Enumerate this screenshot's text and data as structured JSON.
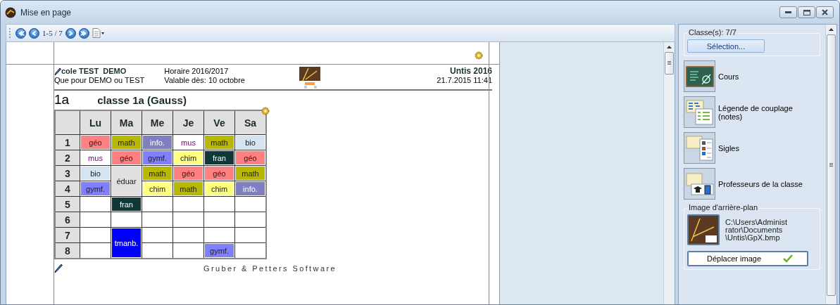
{
  "window": {
    "title": "Mise en page"
  },
  "toolbar": {
    "page_range": "1-5 / 7"
  },
  "page": {
    "school": "cole TEST  DEMO",
    "school_note": "Que pour DEMO ou TEST",
    "schedule": "Horaire 2016/2017",
    "valid_from": "Valable dès: 10 octobre",
    "product": "Untis 2016",
    "timestamp": "21.7.2015 11:41",
    "class_code": "1a",
    "class_name": "classe 1a (Gauss)",
    "footer": "Gruber & Petters Software"
  },
  "table": {
    "columns": [
      "Lu",
      "Ma",
      "Me",
      "Je",
      "Ve",
      "Sa"
    ],
    "rows": [
      {
        "period": "1",
        "cells": [
          {
            "text": "géo",
            "color": "#ff8080",
            "kind": "single"
          },
          {
            "text": "math",
            "color": "#b8b800",
            "kind": "single"
          },
          {
            "text": "info.",
            "color": "#8080c0",
            "kind": "single"
          },
          {
            "text": "mus",
            "color": "#ffffff",
            "kind": "single"
          },
          {
            "text": "math",
            "color": "#b8b800",
            "kind": "single"
          },
          {
            "text": "bio",
            "color": "#d4e4f0",
            "kind": "single"
          }
        ]
      },
      {
        "period": "2",
        "cells": [
          {
            "text": "mus",
            "color": "#ffffff",
            "kind": "single"
          },
          {
            "text": "géo",
            "color": "#ff8080",
            "kind": "single"
          },
          {
            "text": "gymf.",
            "color": "#8080ff",
            "kind": "single"
          },
          {
            "text": "chim",
            "color": "#ffff80",
            "kind": "single"
          },
          {
            "text": "fran",
            "color": "#103838",
            "kind": "single"
          },
          {
            "text": "géo",
            "color": "#ff8080",
            "kind": "single"
          }
        ]
      },
      {
        "period": "3",
        "cells": [
          {
            "text": "bio",
            "color": "#d4e4f0",
            "kind": "single"
          },
          {
            "text": "éduar",
            "color": "#e0e0e0",
            "kind": "double"
          },
          {
            "text": "math",
            "color": "#b8b800",
            "kind": "single"
          },
          {
            "text": "géo",
            "color": "#ff8080",
            "kind": "single"
          },
          {
            "text": "géo",
            "color": "#ff8080",
            "kind": "single"
          },
          {
            "text": "math",
            "color": "#b8b800",
            "kind": "single"
          }
        ]
      },
      {
        "period": "4",
        "cells": [
          {
            "text": "gymf.",
            "color": "#8080ff",
            "kind": "single"
          },
          {
            "kind": "covered"
          },
          {
            "text": "chim",
            "color": "#ffff80",
            "kind": "single"
          },
          {
            "text": "math",
            "color": "#b8b800",
            "kind": "single"
          },
          {
            "text": "chim",
            "color": "#ffff80",
            "kind": "single"
          },
          {
            "text": "info.",
            "color": "#8080c0",
            "kind": "single"
          }
        ]
      },
      {
        "period": "5",
        "cells": [
          {
            "kind": "single"
          },
          {
            "text": "fran",
            "color": "#103838",
            "kind": "single"
          },
          {
            "kind": "single"
          },
          {
            "kind": "single"
          },
          {
            "kind": "single"
          },
          {
            "kind": "single"
          }
        ]
      },
      {
        "period": "6",
        "cells": [
          {
            "kind": "single"
          },
          {
            "kind": "single"
          },
          {
            "kind": "single"
          },
          {
            "kind": "single"
          },
          {
            "kind": "single"
          },
          {
            "kind": "single"
          }
        ]
      },
      {
        "period": "7",
        "cells": [
          {
            "kind": "single"
          },
          {
            "text": "tmanb.",
            "color": "#0000ff",
            "kind": "double"
          },
          {
            "kind": "single"
          },
          {
            "kind": "single"
          },
          {
            "kind": "single"
          },
          {
            "kind": "single"
          }
        ]
      },
      {
        "period": "8",
        "cells": [
          {
            "kind": "single"
          },
          {
            "kind": "covered"
          },
          {
            "kind": "single"
          },
          {
            "kind": "single"
          },
          {
            "text": "gymf.",
            "color": "#8080ff",
            "kind": "single"
          },
          {
            "kind": "single"
          }
        ]
      }
    ]
  },
  "side_panel": {
    "classes_label": "Classe(s): 7/7",
    "selection_button": "Sélection...",
    "items": [
      {
        "label": "Cours",
        "kind": "board"
      },
      {
        "label": "Légende de couplage (notes)",
        "kind": "legend"
      },
      {
        "label": "Sigles",
        "kind": "sigles"
      },
      {
        "label": "Professeurs de la classe",
        "kind": "teachers"
      }
    ],
    "background_image": {
      "label": "Image d'arrière-plan",
      "path": "C:\\Users\\Administrator\\Documents\\Untis\\GpX.bmp",
      "button": "Déplacer image"
    }
  }
}
